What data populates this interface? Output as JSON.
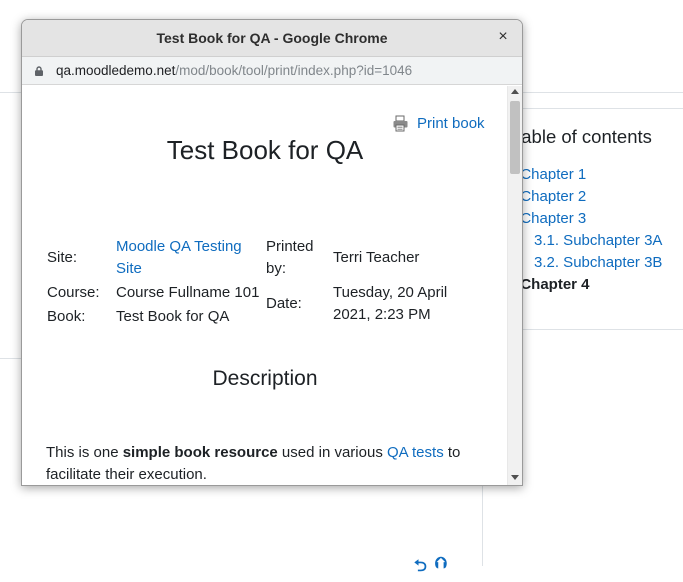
{
  "window": {
    "title": "Test Book for QA - Google Chrome",
    "close": "×",
    "url_host": "qa.moodledemo.net",
    "url_path": "/mod/book/tool/print/index.php?id=1046"
  },
  "print": {
    "print_book_label": "Print book",
    "book_title": "Test Book for QA",
    "site_label": "Site:",
    "site_value_line1": "Moodle QA Testing",
    "site_value_line2": "Site",
    "course_label": "Course:",
    "course_value": "Course Fullname 101",
    "book_label": "Book:",
    "book_value": "Test Book for QA",
    "printed_by_label_line1": "Printed",
    "printed_by_label_line2": "by:",
    "printed_by_value": "Terri Teacher",
    "date_label": "Date:",
    "date_value_line1": "Tuesday, 20 April",
    "date_value_line2": "2021, 2:23 PM",
    "description_heading": "Description",
    "description": {
      "part1": "This is one ",
      "bold": "simple book resource",
      "part2": " used in various ",
      "link": "QA tests",
      "part3": " to",
      "line2": "facilitate their execution."
    }
  },
  "toc": {
    "title": "Table of contents",
    "items": [
      {
        "label": ". Chapter 1"
      },
      {
        "label": ". Chapter 2"
      },
      {
        "label": ". Chapter 3"
      },
      {
        "label": "3.1. Subchapter 3A"
      },
      {
        "label": "3.2. Subchapter 3B"
      },
      {
        "label": ". Chapter 4"
      }
    ]
  },
  "nav": {
    "prev": "⮌",
    "up": "⮉"
  },
  "colors": {
    "link": "#0f6cbf",
    "text": "#1d2125",
    "titlebar": "#e4e4e4"
  },
  "icons": [
    "lock-icon",
    "printer-icon",
    "close-icon"
  ]
}
